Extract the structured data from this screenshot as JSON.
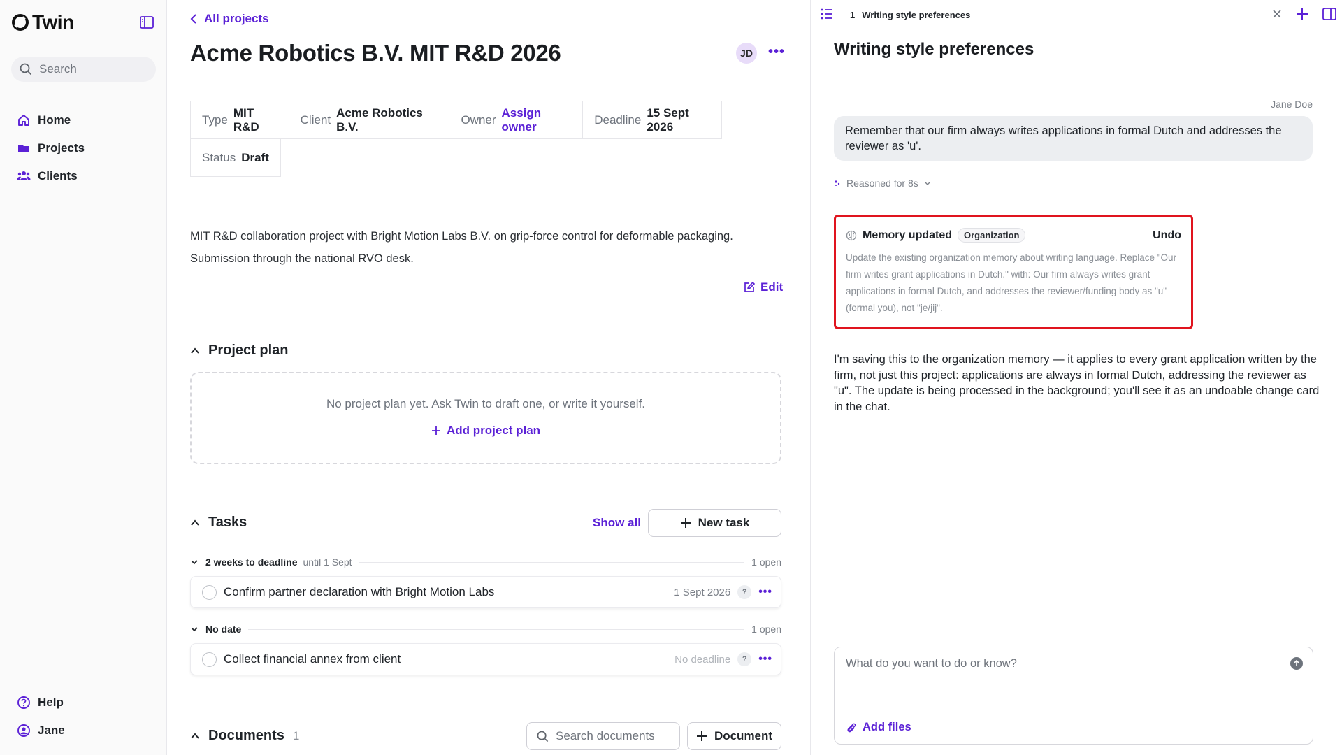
{
  "sidebar": {
    "brand": "Twin",
    "search_placeholder": "Search",
    "nav": [
      {
        "label": "Home",
        "icon": "home-icon"
      },
      {
        "label": "Projects",
        "icon": "folder-icon"
      },
      {
        "label": "Clients",
        "icon": "users-icon"
      }
    ],
    "bottom": [
      {
        "label": "Help",
        "icon": "help-icon"
      },
      {
        "label": "Jane",
        "icon": "user-icon"
      }
    ]
  },
  "main": {
    "back_label": "All projects",
    "title": "Acme Robotics B.V. MIT R&D 2026",
    "avatar_initials": "JD",
    "meta": [
      {
        "label": "Type",
        "value": "MIT R&D"
      },
      {
        "label": "Client",
        "value": "Acme Robotics B.V."
      },
      {
        "label": "Owner",
        "value": "Assign owner"
      },
      {
        "label": "Deadline",
        "value": "15 Sept 2026"
      },
      {
        "label": "Status",
        "value": "Draft"
      }
    ],
    "description_line1": "MIT R&D collaboration project with Bright Motion Labs B.V. on grip-force control for deformable packaging.",
    "description_line2": "Submission through the national RVO desk.",
    "edit_label": "Edit",
    "project_plan": {
      "heading": "Project plan",
      "empty_text": "No project plan yet. Ask Twin to draft one, or write it yourself.",
      "add_label": "Add project plan"
    },
    "tasks": {
      "heading": "Tasks",
      "show_all_label": "Show all",
      "new_task_label": "New task",
      "groups": [
        {
          "title": "2 weeks to deadline",
          "subtitle": "until 1 Sept",
          "count": "1 open",
          "items": [
            {
              "title": "Confirm partner declaration with Bright Motion Labs",
              "date": "1 Sept 2026"
            }
          ]
        },
        {
          "title": "No date",
          "subtitle": "",
          "count": "1 open",
          "items": [
            {
              "title": "Collect financial annex from client",
              "date": "No deadline"
            }
          ]
        }
      ],
      "help_badge": "?"
    },
    "documents": {
      "heading": "Documents",
      "count": "1",
      "search_placeholder": "Search documents",
      "add_label": "Document"
    }
  },
  "panel": {
    "tab_index": "1",
    "tab_title": "Writing style preferences",
    "title": "Writing style preferences",
    "message_author": "Jane Doe",
    "user_message": "Remember that our firm always writes applications in formal Dutch and addresses the reviewer as 'u'.",
    "reasoned_label": "Reasoned for 8s",
    "memory_card": {
      "title": "Memory updated",
      "badge": "Organization",
      "undo_label": "Undo",
      "body": "Update the existing organization memory about writing language. Replace \"Our firm writes grant applications in Dutch.\" with: Our firm always writes grant applications in formal Dutch, and addresses the reviewer/funding body as \"u\" (formal you), not \"je/jij\"."
    },
    "assistant_message": "I'm saving this to the organization memory — it applies to every grant application written by the firm, not just this project: applications are always in formal Dutch, addressing the reviewer as \"u\". The update is being processed in the background; you'll see it as an undoable change card in the chat.",
    "composer_placeholder": "What do you want to do or know?",
    "add_files_label": "Add files"
  },
  "colors": {
    "accent": "#5b21d6",
    "highlight_border": "#e0141e"
  }
}
